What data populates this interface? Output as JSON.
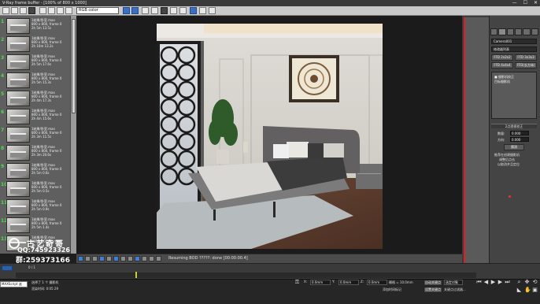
{
  "window": {
    "title": "V-Ray frame buffer - [100% of 800 x 1000]",
    "controls": [
      "—",
      "☐",
      "✕"
    ]
  },
  "toolbar": {
    "channel_select": "RGB color",
    "icons": [
      "save-icon",
      "save-all-icon",
      "copy-icon",
      "clear-icon",
      "red-channel-icon",
      "green-channel-icon",
      "blue-channel-icon",
      "alpha-icon",
      "mono-icon",
      "history-icon",
      "region-icon",
      "lens-effects-icon",
      "compare-icon",
      "stamp-icon",
      "settings-icon"
    ]
  },
  "history": {
    "items": [
      {
        "num": "1",
        "line1": "1结果/卧室.max",
        "line2": "800 x 800, frame 0",
        "line3": "2h 5m 13.5s"
      },
      {
        "num": "2",
        "line1": "1结果/卧室.max",
        "line2": "800 x 800, frame 0",
        "line3": "2h 10m 13.2s"
      },
      {
        "num": "3",
        "line1": "1结果/卧室.max",
        "line2": "800 x 800, frame 0",
        "line3": "2h 5m 17.6s"
      },
      {
        "num": "4",
        "line1": "1结果/卧室.max",
        "line2": "800 x 800, frame 0",
        "line3": "2h 5m 15.3s"
      },
      {
        "num": "5",
        "line1": "1结果/卧室.max",
        "line2": "800 x 800, frame 0",
        "line3": "2h 4m 17.3s"
      },
      {
        "num": "6",
        "line1": "1结果/卧室.max",
        "line2": "800 x 800, frame 0",
        "line3": "2h 4m 15.6s"
      },
      {
        "num": "7",
        "line1": "1结果/卧室.max",
        "line2": "800 x 800, frame 0",
        "line3": "2h 3m 11.5s"
      },
      {
        "num": "8",
        "line1": "1结果/卧室.max",
        "line2": "800 x 800, frame 0",
        "line3": "2h 3m 20.6s"
      },
      {
        "num": "9",
        "line1": "1结果/卧室.max",
        "line2": "800 x 800, frame 0",
        "line3": "2h 5m 0.6s"
      },
      {
        "num": "10",
        "line1": "1结果/卧室.max",
        "line2": "800 x 800, frame 0",
        "line3": "2h 5m 0.5s"
      },
      {
        "num": "11",
        "line1": "1结果/卧室.max",
        "line2": "800 x 800, frame 0",
        "line3": "2h 5m 0.9s"
      },
      {
        "num": "12",
        "line1": "1结果/卧室.max",
        "line2": "800 x 800, frame 0",
        "line3": "2h 5m 1.4s"
      },
      {
        "num": "13",
        "line1": "1结果/卧室.max",
        "line2": "800 x 800, frame 0",
        "line3": "2h 5m 1.9s"
      }
    ]
  },
  "vfb": {
    "status": "Resuming BOD ?????: done [00:00:00.4]"
  },
  "watermark": {
    "title": "古艺奇哥",
    "qq": "QQ:745923326",
    "group": "群:259373166"
  },
  "command_panel": {
    "object_name": "Camera001",
    "modifier_list": "修改器列表",
    "btn_phy": "FFD 2x2x2",
    "btn_ffd": "FFD 3x3x3",
    "btn_ffd4": "FFD 4x4x4",
    "btn_ffd_cyl": "FFD(长方体)",
    "stack_items": [
      "■ 摄影机校正",
      "目标摄影机"
    ],
    "section_correction": "2点透视校正",
    "amount_label": "数量:",
    "amount_value": "0.000",
    "direction_label": "方向:",
    "direction_value": "0.000",
    "guess_label": "猜测",
    "hint_line1": "推荐在创建摄影机",
    "hint_line2": "调整后点击",
    "hint_line3": "以取消并且定位"
  },
  "timeline": {
    "frame": "0 / 1",
    "left_arrow": "◀",
    "right_arrow": "▶"
  },
  "statusbar": {
    "script_field": "MAXScript 迷",
    "selected": "选择了 1 个 摄影机",
    "render_time": "渲染时间: 0:05:29",
    "x_label": "X:",
    "x_value": "0.0mm",
    "y_label": "Y:",
    "y_value": "0.0mm",
    "z_label": "Z:",
    "z_value": "0.0mm",
    "grid": "栅格 = 10.0mm",
    "add_time_tag": "添加时间标记",
    "auto_key": "自动关键点",
    "set_key": "设置关键点",
    "selected_set": "选定对象",
    "key_filters": "关键点过滤器..."
  }
}
